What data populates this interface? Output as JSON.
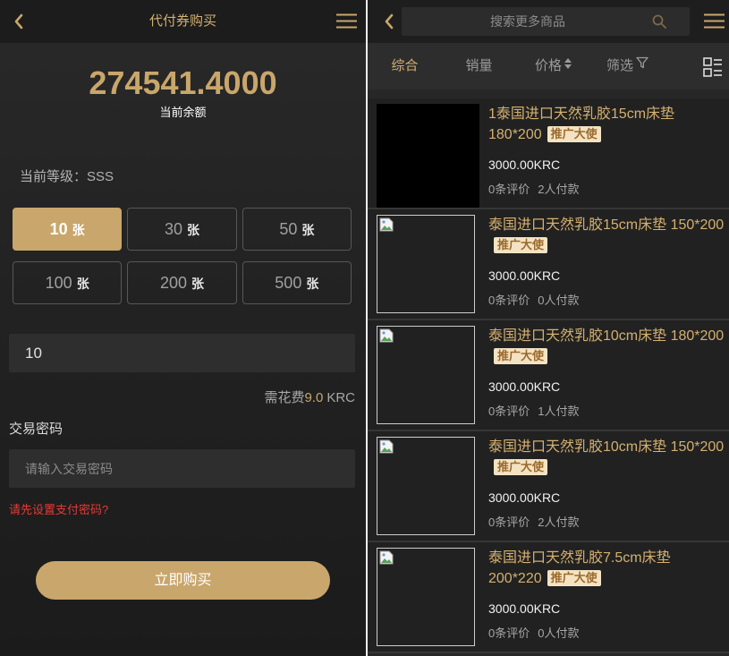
{
  "left": {
    "header": {
      "title": "代付券购买",
      "icons": [
        "back-chevron-icon",
        "menu-icon"
      ]
    },
    "balance": {
      "amount": "274541.4000",
      "label": "当前余额"
    },
    "level": "当前等级：SSS",
    "options": [
      {
        "count": "10",
        "unit": "张",
        "selected": true
      },
      {
        "count": "30",
        "unit": "张",
        "selected": false
      },
      {
        "count": "50",
        "unit": "张",
        "selected": false
      },
      {
        "count": "100",
        "unit": "张",
        "selected": false
      },
      {
        "count": "200",
        "unit": "张",
        "selected": false
      },
      {
        "count": "500",
        "unit": "张",
        "selected": false
      }
    ],
    "quantity": {
      "value": "10"
    },
    "cost": {
      "prefix": "需花费",
      "amount": "9.0",
      "unit": "KRC"
    },
    "password": {
      "label": "交易密码",
      "placeholder": "请输入交易密码"
    },
    "warning": "请先设置支付密码?",
    "submit_label": "立即购买"
  },
  "right": {
    "header": {
      "icons": [
        "back-chevron-icon",
        "search-icon",
        "menu-icon"
      ]
    },
    "search": {
      "placeholder": "搜索更多商品"
    },
    "sort_tabs": [
      {
        "label": "综合",
        "active": true
      },
      {
        "label": "销量",
        "active": false
      },
      {
        "label": "价格",
        "active": false,
        "icon": "sort-arrows-icon"
      },
      {
        "label": "筛选",
        "active": false,
        "icon": "filter-icon"
      }
    ],
    "view_toggle_icon": "list-view-icon",
    "products": [
      {
        "title": "1泰国进口天然乳胶15cm床垫 180*200",
        "badge": "推广大使",
        "price": "3000.00KRC",
        "reviews": "0条评价",
        "payments": "2人付款",
        "image_icon": null
      },
      {
        "title": "泰国进口天然乳胶15cm床垫 150*200",
        "badge": "推广大使",
        "price": "3000.00KRC",
        "reviews": "0条评价",
        "payments": "0人付款",
        "image_icon": "broken-image-icon"
      },
      {
        "title": "泰国进口天然乳胶10cm床垫 180*200",
        "badge": "推广大使",
        "price": "3000.00KRC",
        "reviews": "0条评价",
        "payments": "1人付款",
        "image_icon": "broken-image-icon"
      },
      {
        "title": "泰国进口天然乳胶10cm床垫 150*200",
        "badge": "推广大使",
        "price": "3000.00KRC",
        "reviews": "0条评价",
        "payments": "2人付款",
        "image_icon": "broken-image-icon"
      },
      {
        "title": "泰国进口天然乳胶7.5cm床垫 200*220",
        "badge": "推广大使",
        "price": "3000.00KRC",
        "reviews": "0条评价",
        "payments": "0人付款",
        "image_icon": "broken-image-icon"
      }
    ]
  },
  "colors": {
    "accent": "#c9a66b",
    "accent_text": "#d4b06f",
    "warning": "#e53935",
    "badge_bg": "#f4e3c3",
    "badge_text": "#9b6a2d"
  }
}
